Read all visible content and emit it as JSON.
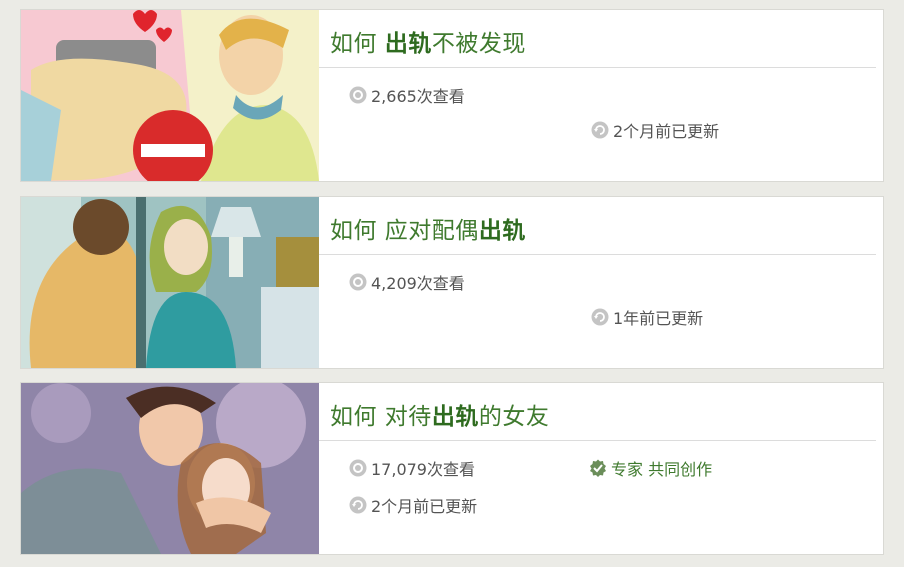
{
  "articles": [
    {
      "prefix": "如何 ",
      "title_bold": "出轨",
      "title_rest": "不被发现",
      "views": "2,665次查看",
      "updated": "2个月前已更新"
    },
    {
      "prefix": "如何 应对配偶",
      "title_bold": "出轨",
      "title_rest": "",
      "views": "4,209次查看",
      "updated": "1年前已更新"
    },
    {
      "prefix": "如何 对待",
      "title_bold": "出轨",
      "title_rest": "的女友",
      "views": "17,079次查看",
      "expert": "专家 共同创作",
      "updated": "2个月前已更新"
    }
  ],
  "colors": {
    "title_green": "#3f7a2e",
    "background": "#ebebe6",
    "icon_gray": "#c4c4c4"
  },
  "icons": [
    "eye-icon",
    "refresh-icon",
    "expert-badge-icon"
  ]
}
